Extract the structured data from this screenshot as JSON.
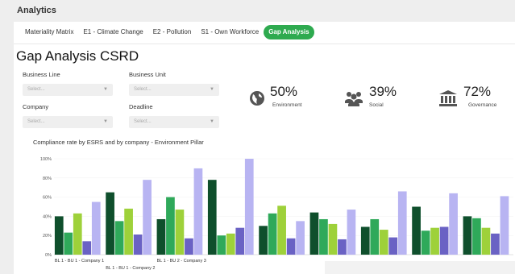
{
  "app": {
    "title": "Analytics"
  },
  "tabs": [
    {
      "label": "Materiality Matrix",
      "active": false
    },
    {
      "label": "E1 - Climate Change",
      "active": false
    },
    {
      "label": "E2 - Pollution",
      "active": false
    },
    {
      "label": "S1 - Own Workforce",
      "active": false
    },
    {
      "label": "Gap Analysis",
      "active": true
    }
  ],
  "page": {
    "title": "Gap Analysis CSRD"
  },
  "filters": {
    "business_line": {
      "label": "Business Line",
      "placeholder": "Select..."
    },
    "business_unit": {
      "label": "Business Unit",
      "placeholder": "Select..."
    },
    "company": {
      "label": "Company",
      "placeholder": "Select..."
    },
    "deadline": {
      "label": "Deadline",
      "placeholder": "Select..."
    }
  },
  "kpis": [
    {
      "value": "50%",
      "label": "Environment",
      "icon": "globe-icon"
    },
    {
      "value": "39%",
      "label": "Social",
      "icon": "people-icon"
    },
    {
      "value": "72%",
      "label": "Governance",
      "icon": "institution-icon"
    }
  ],
  "colors": {
    "accent": "#2eaa4f",
    "series": [
      "#0f4f2c",
      "#2fa95a",
      "#9ed13a",
      "#6a62c4",
      "#b8b4f2"
    ]
  },
  "chart_data": {
    "type": "bar",
    "title": "Compliance rate by ESRS and by company - Environment Pillar",
    "ylim": [
      0,
      100
    ],
    "yticks": [
      "0%",
      "20%",
      "40%",
      "60%",
      "80%",
      "100%"
    ],
    "categories": [
      "BL 1 - BU 1 - Company 1",
      "BL 1 - BU 1 - Company 2",
      "BL 1 - BU 2 - Company 3",
      "",
      "",
      "",
      "",
      "",
      ""
    ],
    "series": [
      {
        "values": [
          40,
          65,
          37,
          78,
          30,
          44,
          29,
          50,
          40
        ]
      },
      {
        "values": [
          23,
          35,
          60,
          20,
          43,
          37,
          37,
          25,
          38
        ]
      },
      {
        "values": [
          43,
          48,
          47,
          22,
          51,
          32,
          26,
          28,
          28
        ]
      },
      {
        "values": [
          14,
          21,
          17,
          28,
          17,
          16,
          18,
          29,
          22
        ]
      },
      {
        "values": [
          55,
          78,
          90,
          100,
          35,
          47,
          66,
          64,
          61
        ]
      }
    ]
  }
}
